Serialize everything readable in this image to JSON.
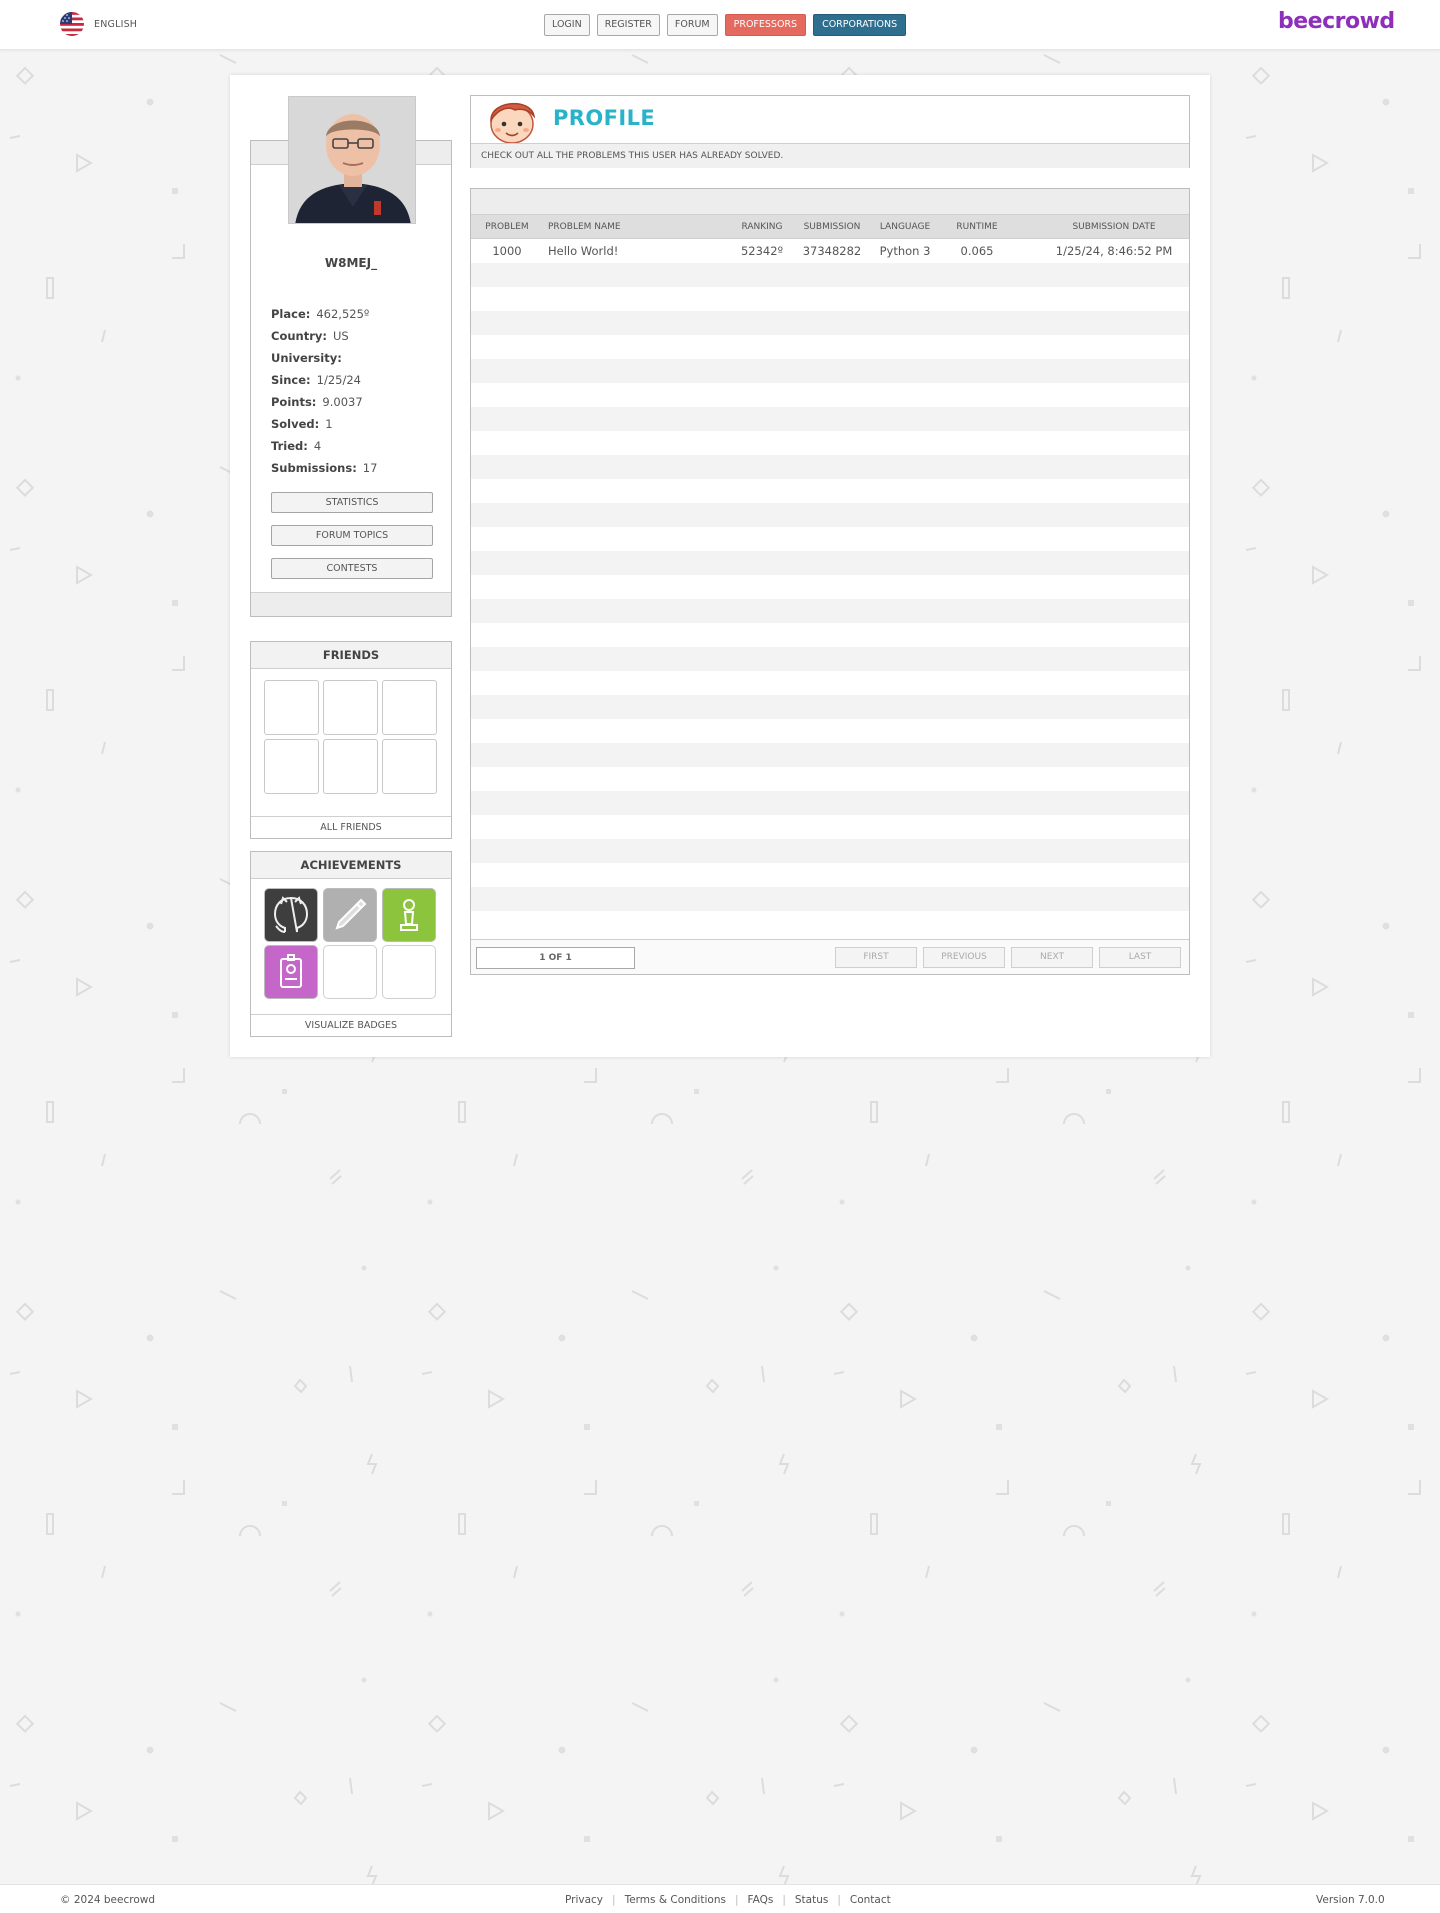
{
  "header": {
    "language": "ENGLISH",
    "nav": {
      "login": "LOGIN",
      "register": "REGISTER",
      "forum": "FORUM",
      "professors": "PROFESSORS",
      "corporations": "CORPORATIONS"
    },
    "brand": "beecrowd"
  },
  "user": {
    "username": "W8MEJ_",
    "info": [
      {
        "key": "Place:",
        "value": "462,525º"
      },
      {
        "key": "Country:",
        "value": "US"
      },
      {
        "key": "University:",
        "value": ""
      },
      {
        "key": "Since:",
        "value": "1/25/24"
      },
      {
        "key": "Points:",
        "value": "9.0037"
      },
      {
        "key": "Solved:",
        "value": "1"
      },
      {
        "key": "Tried:",
        "value": "4"
      },
      {
        "key": "Submissions:",
        "value": "17"
      }
    ],
    "buttons": {
      "statistics": "STATISTICS",
      "forum_topics": "FORUM TOPICS",
      "contests": "CONTESTS"
    }
  },
  "friends": {
    "title": "FRIENDS",
    "footer": "ALL FRIENDS"
  },
  "achievements": {
    "title": "ACHIEVEMENTS",
    "footer": "VISUALIZE BADGES",
    "badges": [
      "github-badge-icon",
      "pencil-badge-icon",
      "chess-pawn-badge-icon",
      "id-card-badge-icon"
    ]
  },
  "profile": {
    "title": "PROFILE",
    "subtitle": "CHECK OUT ALL THE PROBLEMS THIS USER HAS ALREADY SOLVED."
  },
  "table": {
    "columns": {
      "problem": "PROBLEM",
      "problem_name": "PROBLEM NAME",
      "ranking": "RANKING",
      "submission": "SUBMISSION",
      "language": "LANGUAGE",
      "runtime": "RUNTIME",
      "submission_date": "SUBMISSION DATE"
    },
    "rows": [
      {
        "problem": "1000",
        "problem_name": "Hello World!",
        "ranking": "52342º",
        "submission": "37348282",
        "language": "Python 3",
        "runtime": "0.065",
        "submission_date": "1/25/24, 8:46:52 PM"
      }
    ],
    "pagination": {
      "indicator": "1 OF 1",
      "first": "FIRST",
      "previous": "PREVIOUS",
      "next": "NEXT",
      "last": "LAST"
    }
  },
  "footer": {
    "copyright": "© 2024 beecrowd",
    "links": {
      "privacy": "Privacy",
      "terms": "Terms & Conditions",
      "faqs": "FAQs",
      "status": "Status",
      "contact": "Contact"
    },
    "version": "Version 7.0.0"
  },
  "colors": {
    "brand": "#8e2fbb",
    "profile_title": "#2ab3c8",
    "professors": "#e4695e",
    "corporations": "#2e6f90"
  }
}
